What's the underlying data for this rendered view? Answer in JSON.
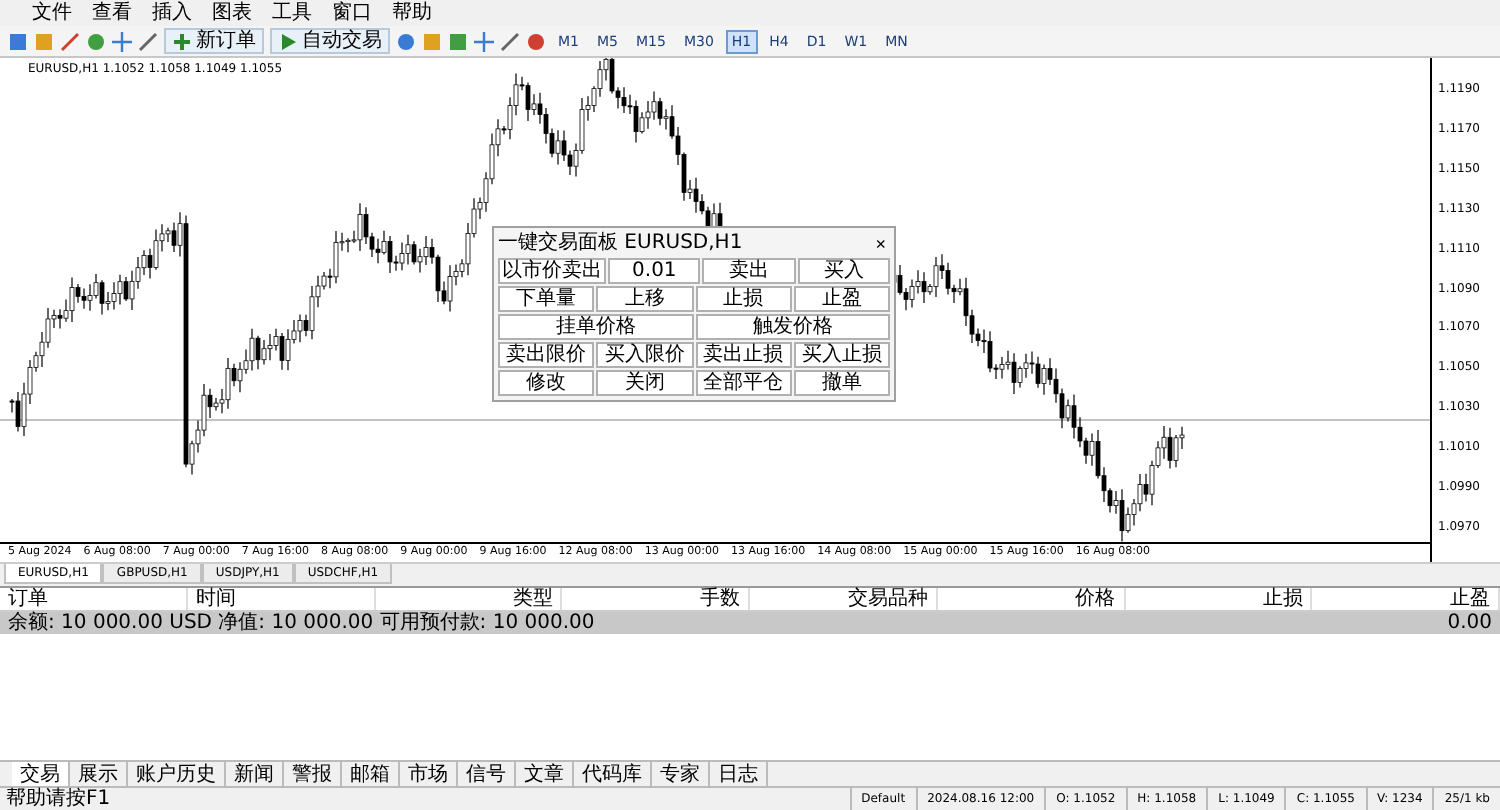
{
  "menu": [
    "文件",
    "查看",
    "插入",
    "图表",
    "工具",
    "窗口",
    "帮助"
  ],
  "toolbar": {
    "buttons": [
      {
        "label": "新订单",
        "kind": "order"
      },
      {
        "label": "自动交易",
        "kind": "auto"
      }
    ],
    "timeframes": [
      {
        "label": "M1",
        "selected": false
      },
      {
        "label": "M5",
        "selected": false
      },
      {
        "label": "M15",
        "selected": false
      },
      {
        "label": "M30",
        "selected": false
      },
      {
        "label": "H1",
        "selected": true
      },
      {
        "label": "H4",
        "selected": false
      },
      {
        "label": "D1",
        "selected": false
      },
      {
        "label": "W1",
        "selected": false
      },
      {
        "label": "MN",
        "selected": false
      }
    ]
  },
  "chart": {
    "title": "EURUSD,H1  1.1052 1.1058 1.1049 1.1055",
    "price_labels": [
      "1.1190",
      "1.1170",
      "1.1150",
      "1.1130",
      "1.1110",
      "1.1090",
      "1.1070",
      "1.1050",
      "1.1030",
      "1.1010",
      "1.0990",
      "1.0970"
    ],
    "time_labels": [
      "5 Aug 2024",
      "6 Aug 08:00",
      "7 Aug 00:00",
      "7 Aug 16:00",
      "8 Aug 08:00",
      "9 Aug 00:00",
      "9 Aug 16:00",
      "12 Aug 08:00",
      "13 Aug 00:00",
      "13 Aug 16:00",
      "14 Aug 08:00",
      "15 Aug 00:00",
      "15 Aug 16:00",
      "16 Aug 08:00"
    ],
    "trade_panel": {
      "title": "一键交易面板 EURUSD,H1",
      "close": "×",
      "rows": [
        [
          "以市价卖出",
          "0.01",
          "卖出",
          "买入"
        ],
        [
          "下单量",
          "上移",
          "止损",
          "止盈"
        ],
        [
          "挂单价格",
          "触发价格"
        ],
        [
          "卖出限价",
          "买入限价",
          "卖出止损",
          "买入止损"
        ],
        [
          "修改",
          "关闭",
          "全部平仓",
          "撤单"
        ]
      ]
    }
  },
  "chart_tabs": [
    {
      "label": "EURUSD,H1",
      "selected": true
    },
    {
      "label": "GBPUSD,H1",
      "selected": false
    },
    {
      "label": "USDJPY,H1",
      "selected": false
    },
    {
      "label": "USDCHF,H1",
      "selected": false
    }
  ],
  "terminal": {
    "columns": [
      "订单",
      "时间",
      "类型",
      "手数",
      "交易品种",
      "价格",
      "止损",
      "止盈"
    ],
    "balance_row": {
      "text": "余额: 10 000.00 USD  净值: 10 000.00  可用预付款: 10 000.00",
      "profit": "0.00"
    },
    "tabs": [
      {
        "label": "交易",
        "selected": true
      },
      {
        "label": "展示",
        "selected": false
      },
      {
        "label": "账户历史",
        "selected": false
      },
      {
        "label": "新闻",
        "selected": false
      },
      {
        "label": "警报",
        "selected": false
      },
      {
        "label": "邮箱",
        "selected": false
      },
      {
        "label": "市场",
        "selected": false
      },
      {
        "label": "信号",
        "selected": false
      },
      {
        "label": "文章",
        "selected": false
      },
      {
        "label": "代码库",
        "selected": false
      },
      {
        "label": "专家",
        "selected": false
      },
      {
        "label": "日志",
        "selected": false
      }
    ]
  },
  "status_bar": {
    "help": "帮助请按F1",
    "items": [
      "Default",
      "2024.08.16 12:00",
      "O: 1.1052",
      "H: 1.1058",
      "L: 1.1049",
      "C: 1.1055",
      "V: 1234",
      "25/1 kb"
    ]
  }
}
